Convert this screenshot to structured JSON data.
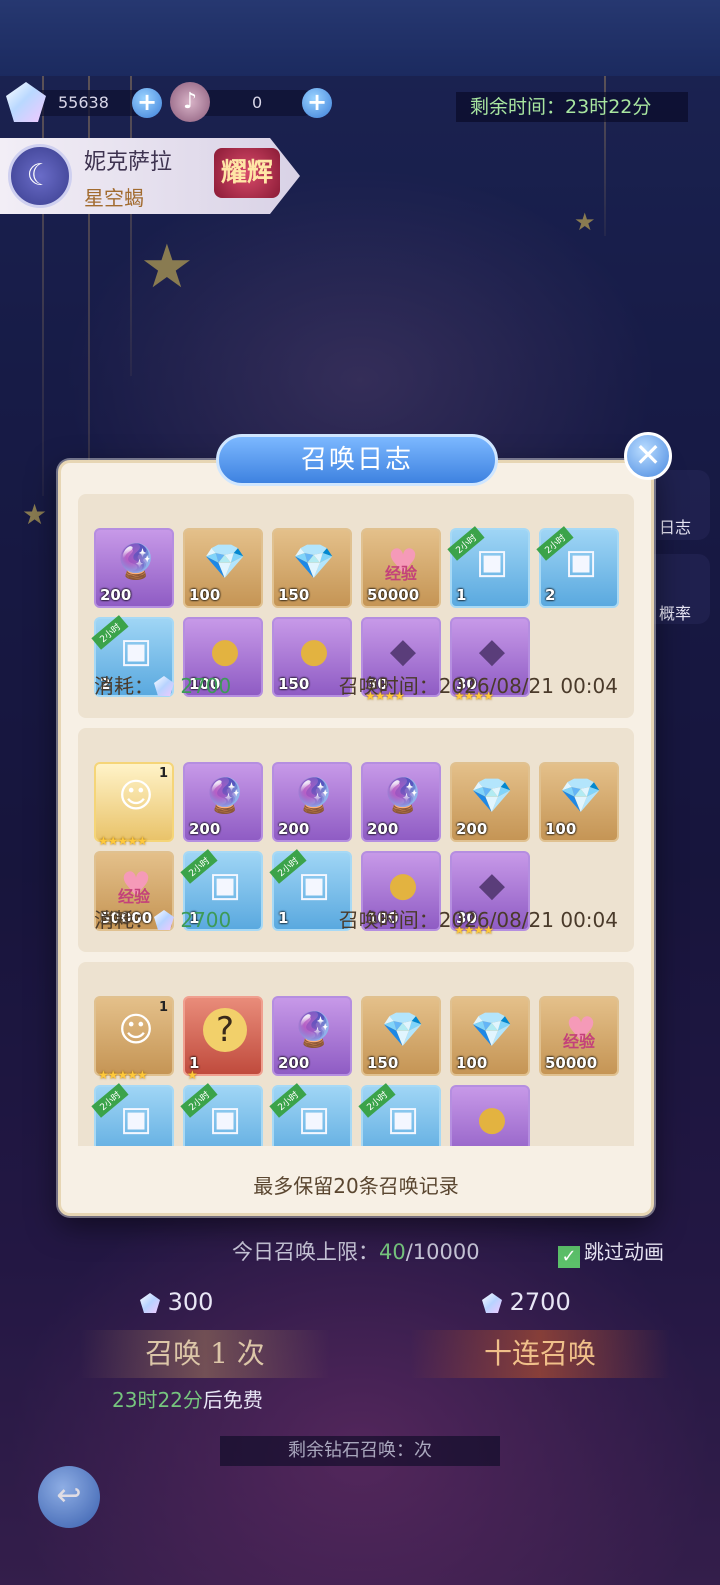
{
  "currency": {
    "gems": "55638",
    "tokens": "0",
    "plus": "+",
    "timer_label": "剩余时间：",
    "timer_value": "23时22分"
  },
  "character": {
    "name": "妮克萨拉",
    "title": "星空蝎",
    "rank": "耀辉"
  },
  "side": {
    "log": "日志",
    "rate": "概率"
  },
  "modal": {
    "title": "召唤日志",
    "close": "✕",
    "note": "最多保留20条召唤记录",
    "cost_label": "消耗：",
    "time_label": "召唤时间：",
    "records": [
      {
        "cost": "2700",
        "time": "2026/08/21 00:04",
        "items": [
          {
            "icon": "crystal-ball-icon",
            "color": "purple",
            "count": "200"
          },
          {
            "icon": "diamond-icon",
            "color": "gold",
            "count": "100"
          },
          {
            "icon": "diamond-icon",
            "color": "gold",
            "count": "150"
          },
          {
            "icon": "exp-heart-icon",
            "color": "gold",
            "count": "50000",
            "label": "经验"
          },
          {
            "icon": "treasure-chest-icon",
            "color": "blue",
            "count": "1",
            "tag": "2小时"
          },
          {
            "icon": "treasure-chest-icon",
            "color": "blue",
            "count": "2",
            "tag": "2小时"
          },
          {
            "icon": "treasure-chest-icon",
            "color": "blue",
            "count": "2",
            "tag": "2小时"
          },
          {
            "icon": "golden-egg-icon",
            "color": "purple",
            "count": "100"
          },
          {
            "icon": "golden-egg-icon",
            "color": "purple",
            "count": "150"
          },
          {
            "icon": "shadow-shard-icon",
            "color": "purple",
            "count": "30",
            "stars": "★★★★"
          },
          {
            "icon": "shadow-shard-icon",
            "color": "purple",
            "count": "30",
            "stars": "★★★★"
          }
        ]
      },
      {
        "cost": "2700",
        "time": "2026/08/21 00:04",
        "items": [
          {
            "icon": "hero-portrait-icon",
            "color": "hero",
            "count": "",
            "level": "1",
            "stars": "★★★★★"
          },
          {
            "icon": "crystal-ball-icon",
            "color": "purple",
            "count": "200"
          },
          {
            "icon": "crystal-ball-icon",
            "color": "purple",
            "count": "200"
          },
          {
            "icon": "crystal-ball-icon",
            "color": "purple",
            "count": "200"
          },
          {
            "icon": "diamond-icon",
            "color": "gold",
            "count": "200"
          },
          {
            "icon": "diamond-icon",
            "color": "gold",
            "count": "100"
          },
          {
            "icon": "exp-heart-icon",
            "color": "gold",
            "count": "50000",
            "label": "经验"
          },
          {
            "icon": "treasure-chest-icon",
            "color": "blue",
            "count": "1",
            "tag": "2小时"
          },
          {
            "icon": "treasure-chest-icon",
            "color": "blue",
            "count": "1",
            "tag": "2小时"
          },
          {
            "icon": "golden-egg-icon",
            "color": "purple",
            "count": "100"
          },
          {
            "icon": "shadow-shard-icon",
            "color": "purple",
            "count": "30",
            "stars": "★★★★"
          }
        ]
      },
      {
        "cost": "",
        "time": "",
        "items": [
          {
            "icon": "hero-portrait-icon",
            "color": "gold",
            "count": "",
            "level": "1",
            "stars": "★★★★★"
          },
          {
            "icon": "mystery-box-icon",
            "color": "red",
            "count": "1",
            "stars": "★"
          },
          {
            "icon": "crystal-ball-icon",
            "color": "purple",
            "count": "200"
          },
          {
            "icon": "diamond-icon",
            "color": "gold",
            "count": "150"
          },
          {
            "icon": "diamond-icon",
            "color": "gold",
            "count": "100"
          },
          {
            "icon": "exp-heart-icon",
            "color": "gold",
            "count": "50000",
            "label": "经验"
          },
          {
            "icon": "treasure-chest-icon",
            "color": "blue",
            "count": "",
            "tag": "2小时"
          },
          {
            "icon": "treasure-chest-icon",
            "color": "blue",
            "count": "",
            "tag": "2小时"
          },
          {
            "icon": "treasure-chest-icon",
            "color": "blue",
            "count": "",
            "tag": "2小时"
          },
          {
            "icon": "treasure-chest-icon",
            "color": "blue",
            "count": "",
            "tag": "2小时"
          },
          {
            "icon": "golden-egg-icon",
            "color": "purple",
            "count": ""
          }
        ]
      }
    ]
  },
  "bottom": {
    "limit_label": "今日召唤上限：",
    "limit_used": "40",
    "limit_total": "/10000",
    "skip_label": "跳过动画",
    "cost_single": "300",
    "cost_ten": "2700",
    "summon_one": "召唤 1 次",
    "summon_ten": "十连召唤",
    "free_time": "23时22分",
    "free_suffix": "后免费",
    "remain_label": "剩余钻石召唤：",
    "remain_unit": "次"
  },
  "colors": {
    "accent_blue": "#3e82e0",
    "green_value": "#3d9a57",
    "modal_bg": "#f7f0e5"
  }
}
